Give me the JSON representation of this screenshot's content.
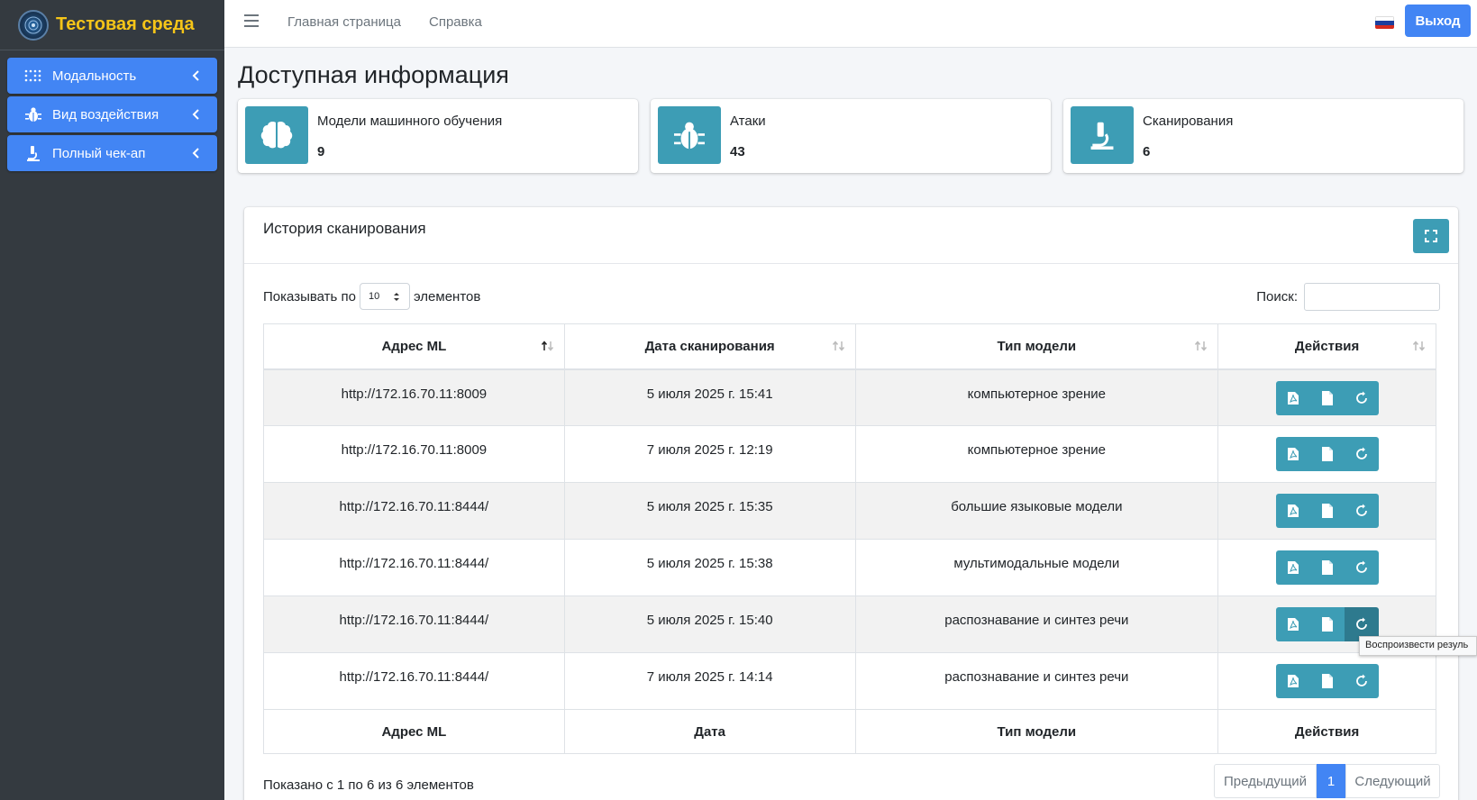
{
  "brand": {
    "title": "Тестовая среда"
  },
  "sidebar": {
    "items": [
      {
        "label": "Модальность",
        "icon": "grid-dots-icon"
      },
      {
        "label": "Вид воздействия",
        "icon": "bug-icon"
      },
      {
        "label": "Полный чек-ап",
        "icon": "microscope-icon"
      }
    ]
  },
  "topbar": {
    "links": [
      "Главная страница",
      "Справка"
    ],
    "logout_label": "Выход",
    "language_flag": "ru"
  },
  "page": {
    "title": "Доступная информация"
  },
  "info_boxes": [
    {
      "label": "Модели машинного обучения",
      "value": "9",
      "icon": "brain-icon"
    },
    {
      "label": "Атаки",
      "value": "43",
      "icon": "bug-icon"
    },
    {
      "label": "Сканирования",
      "value": "6",
      "icon": "microscope-icon"
    }
  ],
  "card": {
    "title": "История сканирования",
    "length": {
      "prefix": "Показывать по",
      "value": "10",
      "suffix": "элементов"
    },
    "search": {
      "label": "Поиск:",
      "value": ""
    },
    "columns": [
      "Адрес ML",
      "Дата сканирования",
      "Тип модели",
      "Действия"
    ],
    "footer_columns": [
      "Адрес ML",
      "Дата",
      "Тип модели",
      "Действия"
    ],
    "rows": [
      {
        "address": "http://172.16.70.11:8009",
        "date": "5 июля 2025 г. 15:41",
        "model_type": "компьютерное зрение"
      },
      {
        "address": "http://172.16.70.11:8009",
        "date": "7 июля 2025 г. 12:19",
        "model_type": "компьютерное зрение"
      },
      {
        "address": "http://172.16.70.11:8444/",
        "date": "5 июля 2025 г. 15:35",
        "model_type": "большие языковые модели"
      },
      {
        "address": "http://172.16.70.11:8444/",
        "date": "5 июля 2025 г. 15:38",
        "model_type": "мультимодальные модели"
      },
      {
        "address": "http://172.16.70.11:8444/",
        "date": "5 июля 2025 г. 15:40",
        "model_type": "распознавание и синтез речи"
      },
      {
        "address": "http://172.16.70.11:8444/",
        "date": "7 июля 2025 г. 14:14",
        "model_type": "распознавание и синтез речи"
      }
    ],
    "tooltip": "Воспроизвести резуль",
    "info_text": "Показано с 1 по 6 из 6 элементов",
    "pagination": {
      "prev": "Предыдущий",
      "current": "1",
      "next": "Следующий"
    }
  },
  "colors": {
    "primary": "#4285f4",
    "teal": "#3d9db5",
    "sidebar": "#343a40",
    "brand": "#f5c518"
  }
}
